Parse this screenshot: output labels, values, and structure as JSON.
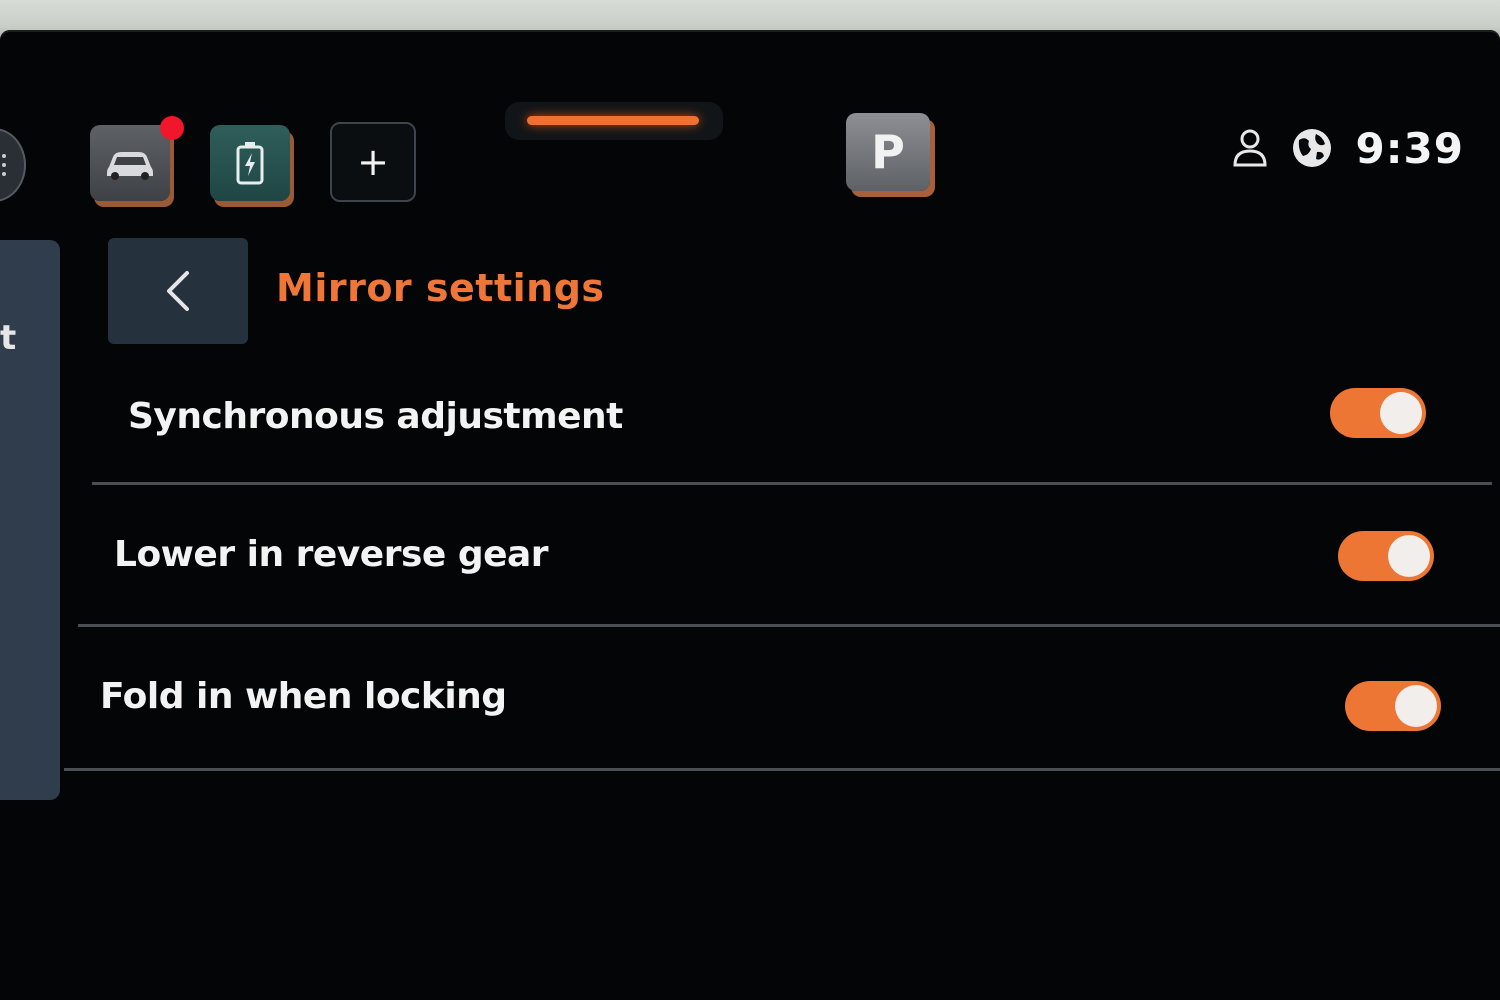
{
  "header": {
    "plus_label": "+",
    "gear_label": "P",
    "clock": "9:39"
  },
  "sidebar": {
    "partial_label": "t"
  },
  "page": {
    "title": "Mirror settings"
  },
  "settings": [
    {
      "label": "Synchronous adjustment",
      "enabled": true
    },
    {
      "label": "Lower in reverse gear",
      "enabled": true
    },
    {
      "label": "Fold in when locking",
      "enabled": true
    }
  ],
  "colors": {
    "accent": "#ee7634",
    "background": "#030507",
    "title": "#ee7638",
    "notification": "#f0172a"
  },
  "icons": [
    "car-icon",
    "battery-icon",
    "plus-icon",
    "profile-icon",
    "globe-icon",
    "back-chevron-icon"
  ]
}
